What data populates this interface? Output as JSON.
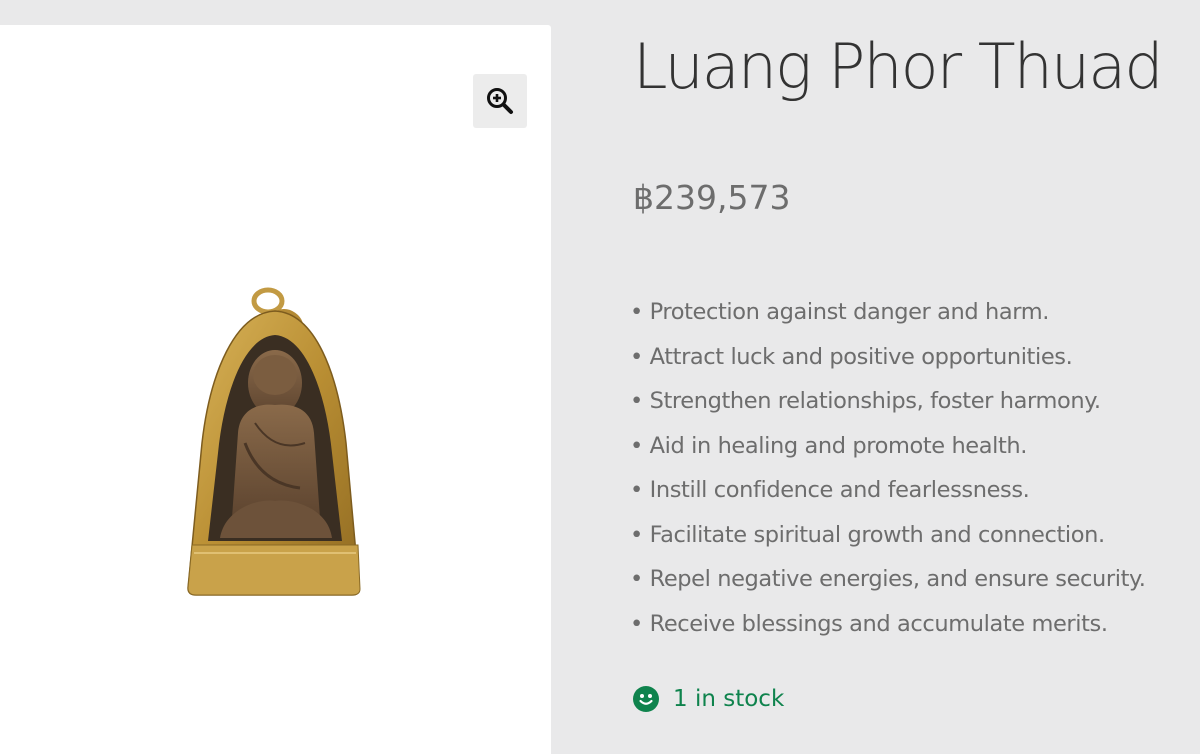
{
  "product": {
    "title": "Luang Phor Thuad",
    "price": "฿239,573",
    "benefits": [
      "• Protection against danger and harm.",
      "• Attract luck and positive opportunities.",
      "• Strengthen relationships, foster harmony.",
      "• Aid in healing and promote health.",
      "• Instill confidence and fearlessness.",
      "• Facilitate spiritual growth and connection.",
      "• Repel negative energies, and ensure security.",
      "• Receive blessings and accumulate merits."
    ],
    "stock": "1 in stock"
  },
  "gallery": {
    "zoom_icon": "zoom-in-icon",
    "image_subject": "amulet-image"
  },
  "colors": {
    "background": "#e9e9ea",
    "stock_green": "#0f834d",
    "text_gray": "#6d6d6d",
    "title": "#333333"
  }
}
